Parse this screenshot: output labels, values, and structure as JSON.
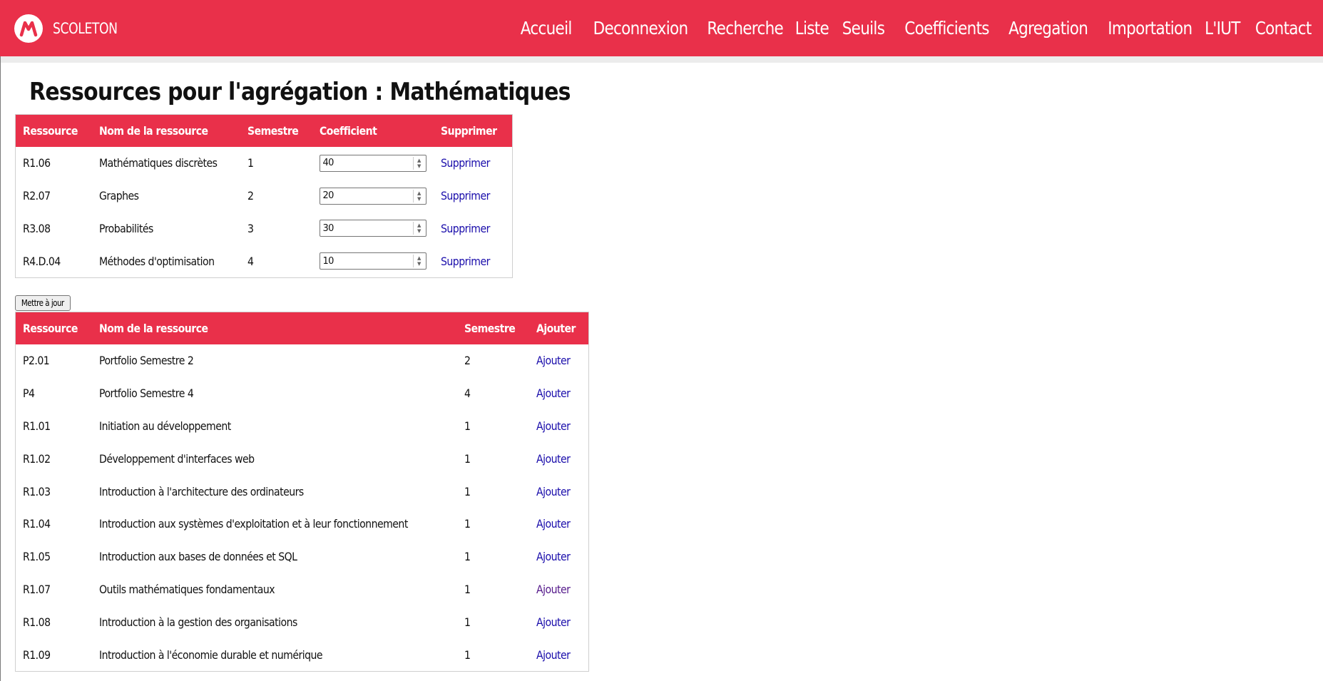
{
  "brand": {
    "name": "SCOLETON",
    "logo_icon": "scoleton-logo-icon"
  },
  "nav": [
    "Accueil",
    "Deconnexion",
    "Recherche",
    "Liste",
    "Seuils",
    "Coefficients",
    "Agregation",
    "Importation",
    "L'IUT",
    "Contact"
  ],
  "page_title": "Ressources pour l'agrégation : Mathématiques",
  "selected_table": {
    "headers": [
      "Ressource",
      "Nom de la ressource",
      "Semestre",
      "Coefficient",
      "Supprimer"
    ],
    "rows": [
      {
        "code": "R1.06",
        "name": "Mathématiques discrètes",
        "semestre": "1",
        "coefficient": "40",
        "action": "Supprimer"
      },
      {
        "code": "R2.07",
        "name": "Graphes",
        "semestre": "2",
        "coefficient": "20",
        "action": "Supprimer"
      },
      {
        "code": "R3.08",
        "name": "Probabilités",
        "semestre": "3",
        "coefficient": "30",
        "action": "Supprimer"
      },
      {
        "code": "R4.D.04",
        "name": "Méthodes d'optimisation",
        "semestre": "4",
        "coefficient": "10",
        "action": "Supprimer"
      }
    ]
  },
  "update_button": "Mettre à jour",
  "available_table": {
    "headers": [
      "Ressource",
      "Nom de la ressource",
      "Semestre",
      "Ajouter"
    ],
    "rows": [
      {
        "code": "P2.01",
        "name": "Portfolio Semestre 2",
        "semestre": "2",
        "action": "Ajouter"
      },
      {
        "code": "P4",
        "name": "Portfolio Semestre 4",
        "semestre": "4",
        "action": "Ajouter"
      },
      {
        "code": "R1.01",
        "name": "Initiation au développement",
        "semestre": "1",
        "action": "Ajouter"
      },
      {
        "code": "R1.02",
        "name": "Développement d'interfaces web",
        "semestre": "1",
        "action": "Ajouter"
      },
      {
        "code": "R1.03",
        "name": "Introduction à l'architecture des ordinateurs",
        "semestre": "1",
        "action": "Ajouter"
      },
      {
        "code": "R1.04",
        "name": "Introduction aux systèmes d'exploitation et à leur fonctionnement",
        "semestre": "1",
        "action": "Ajouter"
      },
      {
        "code": "R1.05",
        "name": "Introduction aux bases de données et SQL",
        "semestre": "1",
        "action": "Ajouter"
      },
      {
        "code": "R1.07",
        "name": "Outils mathématiques fondamentaux",
        "semestre": "1",
        "action": "Ajouter",
        "visited": true
      },
      {
        "code": "R1.08",
        "name": "Introduction à la gestion des organisations",
        "semestre": "1",
        "action": "Ajouter"
      },
      {
        "code": "R1.09",
        "name": "Introduction à l'économie durable et numérique",
        "semestre": "1",
        "action": "Ajouter"
      }
    ]
  },
  "colors": {
    "accent": "#e9304a",
    "link": "#1a0dab",
    "visited_link": "#551a8b"
  }
}
